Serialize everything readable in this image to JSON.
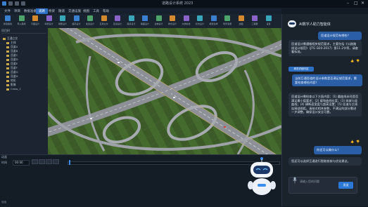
{
  "window": {
    "title": "道路设计系统 2023"
  },
  "menu": {
    "tabs": [
      "文件",
      "项目",
      "数据准备",
      "道路",
      "桥梁",
      "隧道",
      "交通设施",
      "视图",
      "工具",
      "帮助"
    ],
    "active_index": 3
  },
  "ribbon": {
    "buttons": [
      {
        "label": "新建路线",
        "icon": "road-new-icon"
      },
      {
        "label": "导入路线",
        "icon": "road-import-icon"
      },
      {
        "label": "平面设计",
        "icon": "plan-icon"
      },
      {
        "label": "纵断设计",
        "icon": "profile-icon"
      },
      {
        "label": "横断设计",
        "icon": "cross-section-icon"
      },
      {
        "label": "超高设计",
        "icon": "superelevation-icon"
      },
      {
        "label": "加宽设计",
        "icon": "widen-icon"
      },
      {
        "label": "互通立交",
        "icon": "interchange-icon"
      },
      {
        "label": "匝道设计",
        "icon": "ramp-icon"
      },
      {
        "label": "路基设计",
        "icon": "subgrade-icon"
      },
      {
        "label": "路面设计",
        "icon": "pavement-icon"
      },
      {
        "label": "边坡设计",
        "icon": "slope-icon"
      },
      {
        "label": "排水设计",
        "icon": "drain-icon"
      },
      {
        "label": "交通标线",
        "icon": "marking-icon"
      },
      {
        "label": "标志设计",
        "icon": "sign-icon"
      },
      {
        "label": "模型生成",
        "icon": "model-icon"
      },
      {
        "label": "场景漫游",
        "icon": "roam-icon"
      },
      {
        "label": "出图",
        "icon": "drawing-icon"
      },
      {
        "label": "工程量",
        "icon": "quantity-icon"
      },
      {
        "label": "设置",
        "icon": "gear-icon"
      }
    ]
  },
  "left_panel": {
    "title": "项目树",
    "items": [
      "互通立交",
      "主线",
      "匝道A",
      "匝道B",
      "匝道C",
      "匝道D",
      "匝道E",
      "匝道F",
      "匝道G",
      "匝道H",
      "地形",
      "影像",
      "Cross_1"
    ]
  },
  "bottom_panel": {
    "title": "动画",
    "time_label": "时间",
    "time_value": "00:00",
    "status": "就绪"
  },
  "assistant": {
    "title": "AI数字人助力智能体",
    "messages": [
      {
        "role": "user",
        "text": "匝道设计规范有哪些？"
      },
      {
        "role": "assistant",
        "text": "匝道设计需遵循相关规范要求，主要包括《公路路线设计规范》（JTG D20-2017）第11.2节等，请查看标准。"
      },
      {
        "role": "tag",
        "text": "规范详细内容"
      },
      {
        "role": "user",
        "text": "当前互通匝道的设计参数是否满足规范要求，需要检查哪些内容？"
      },
      {
        "role": "assistant",
        "text": "匝道设计需检查以下方面内容：(1) 圆曲线半径是否满足最小值要求；(2) 缓和曲线长度；(3) 纵坡与竖曲线；(4) 横断面宽度与超高设置；(5) 匝道与主线连接部视距。请核对相关参数，不满足的部分需进一步调整，确保设计安全可靠。"
      },
      {
        "role": "user",
        "text": "你还可以做什么？"
      },
      {
        "role": "assistant",
        "text": "您还可以选择互通进行智能校核与优化建议。"
      }
    ],
    "input_placeholder": "请输入您的问题",
    "send_label": "发送"
  },
  "colors": {
    "accent": "#2c6fc4",
    "grass": "#3e5a2a",
    "road": "#b7bcc2"
  }
}
